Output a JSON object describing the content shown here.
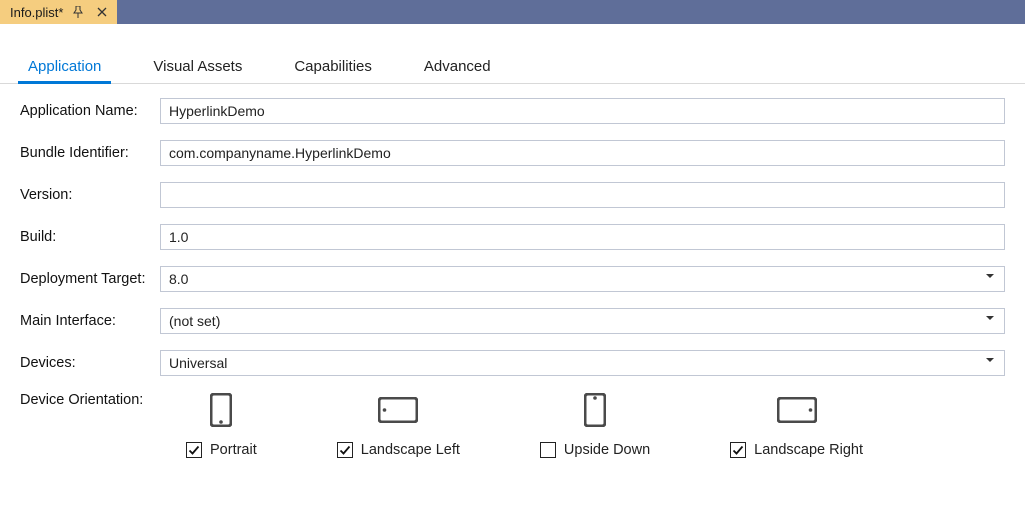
{
  "titlebar": {
    "doc_title": "Info.plist*"
  },
  "tabs": {
    "t0": "Application",
    "t1": "Visual Assets",
    "t2": "Capabilities",
    "t3": "Advanced"
  },
  "labels": {
    "app_name": "Application Name:",
    "bundle_id": "Bundle Identifier:",
    "version": "Version:",
    "build": "Build:",
    "deploy_target": "Deployment Target:",
    "main_interface": "Main Interface:",
    "devices": "Devices:",
    "orientation": "Device Orientation:"
  },
  "values": {
    "app_name": "HyperlinkDemo",
    "bundle_id": "com.companyname.HyperlinkDemo",
    "version": "",
    "build": "1.0",
    "deploy_target": "8.0",
    "main_interface": "(not set)",
    "devices": "Universal"
  },
  "orientations": {
    "o0": {
      "label": "Portrait",
      "checked": true
    },
    "o1": {
      "label": "Landscape Left",
      "checked": true
    },
    "o2": {
      "label": "Upside Down",
      "checked": false
    },
    "o3": {
      "label": "Landscape Right",
      "checked": true
    }
  },
  "colors": {
    "accent": "#0078d7",
    "icon": "#4a4a4a"
  }
}
